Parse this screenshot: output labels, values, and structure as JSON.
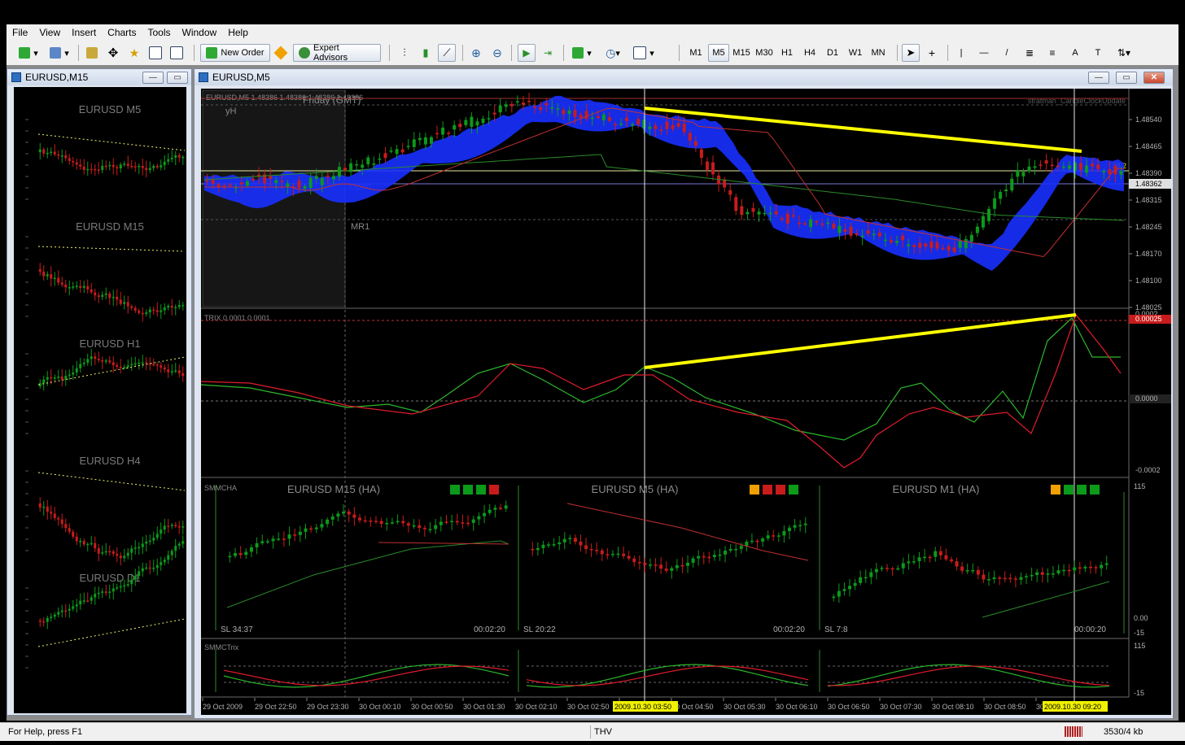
{
  "menu": [
    "File",
    "View",
    "Insert",
    "Charts",
    "Tools",
    "Window",
    "Help"
  ],
  "toolbar": {
    "new_order": "New Order",
    "expert_advisors": "Expert Advisors",
    "timeframes": [
      "M1",
      "M5",
      "M15",
      "M30",
      "H1",
      "H4",
      "D1",
      "W1",
      "MN"
    ],
    "active_timeframe": "M5",
    "draw_tools": [
      "|",
      "—",
      "/",
      "A",
      "T"
    ]
  },
  "left_window": {
    "title": "EURUSD,M15",
    "panels": [
      "EURUSD M5",
      "EURUSD M15",
      "EURUSD H1",
      "EURUSD H4",
      "EURUSD D1"
    ]
  },
  "main_window": {
    "title": "EURUSD,M5",
    "info_line": "EURUSD,M5  1.48386 1.48386 1.48386 1.48386",
    "friday_label": "Friday  (GMT)",
    "yh_label": "yH",
    "open_label": "Open",
    "mr1_label": "MR1",
    "clock_label": "stratman_CandleClockUpdate",
    "fib_label": "38.2",
    "price_ticks": [
      "1.48540",
      "1.48465",
      "1.48390",
      "1.48315",
      "1.48245",
      "1.48170",
      "1.48100",
      "1.48025"
    ],
    "current_price": "1.48362",
    "trix_label": "TRIX 0.0001 0.0001",
    "trix_ticks": [
      "0.0002",
      "0.00025",
      "0.0000",
      "-0.0002"
    ],
    "smmcha_label": "SMMCHA",
    "smmcha_titles": [
      "EURUSD M15 (HA)",
      "EURUSD M5 (HA)",
      "EURUSD M1 (HA)"
    ],
    "smmcha_sl": [
      "SL 34:37",
      "SL 20:22",
      "SL 7:8"
    ],
    "smmcha_timers": [
      "00:02:20",
      "00:02:20",
      "00:00:20"
    ],
    "smmcha_ticks": [
      "115",
      "0.00",
      "-15"
    ],
    "smmctrix_label": "SMMCTrix",
    "smmctrix_ticks": [
      "115",
      "-15"
    ],
    "time_ticks": [
      "29 Oct 2009",
      "29 Oct 22:50",
      "29 Oct 23:30",
      "30 Oct 00:10",
      "30 Oct 00:50",
      "30 Oct 01:30",
      "30 Oct 02:10",
      "30 Oct 02:50",
      "30 Oct 04:10",
      "30 Oct 04:50",
      "30 Oct 05:30",
      "30 Oct 06:10",
      "30 Oct 06:50",
      "30 Oct 07:30",
      "30 Oct 08:10",
      "30 Oct 08:50",
      "30 Oct 09:30"
    ],
    "time_marker_1": "2009.10.30 03:50",
    "time_marker_2": "2009.10.30 09:20"
  },
  "status": {
    "help": "For Help, press F1",
    "profile": "THV",
    "traffic": "3530/4 kb"
  },
  "colors": {
    "bull": "#0c9a1a",
    "bear": "#c81c1c",
    "cloud": "#1830ff",
    "trend": "#ffff00",
    "grid": "#3a3a3a"
  }
}
